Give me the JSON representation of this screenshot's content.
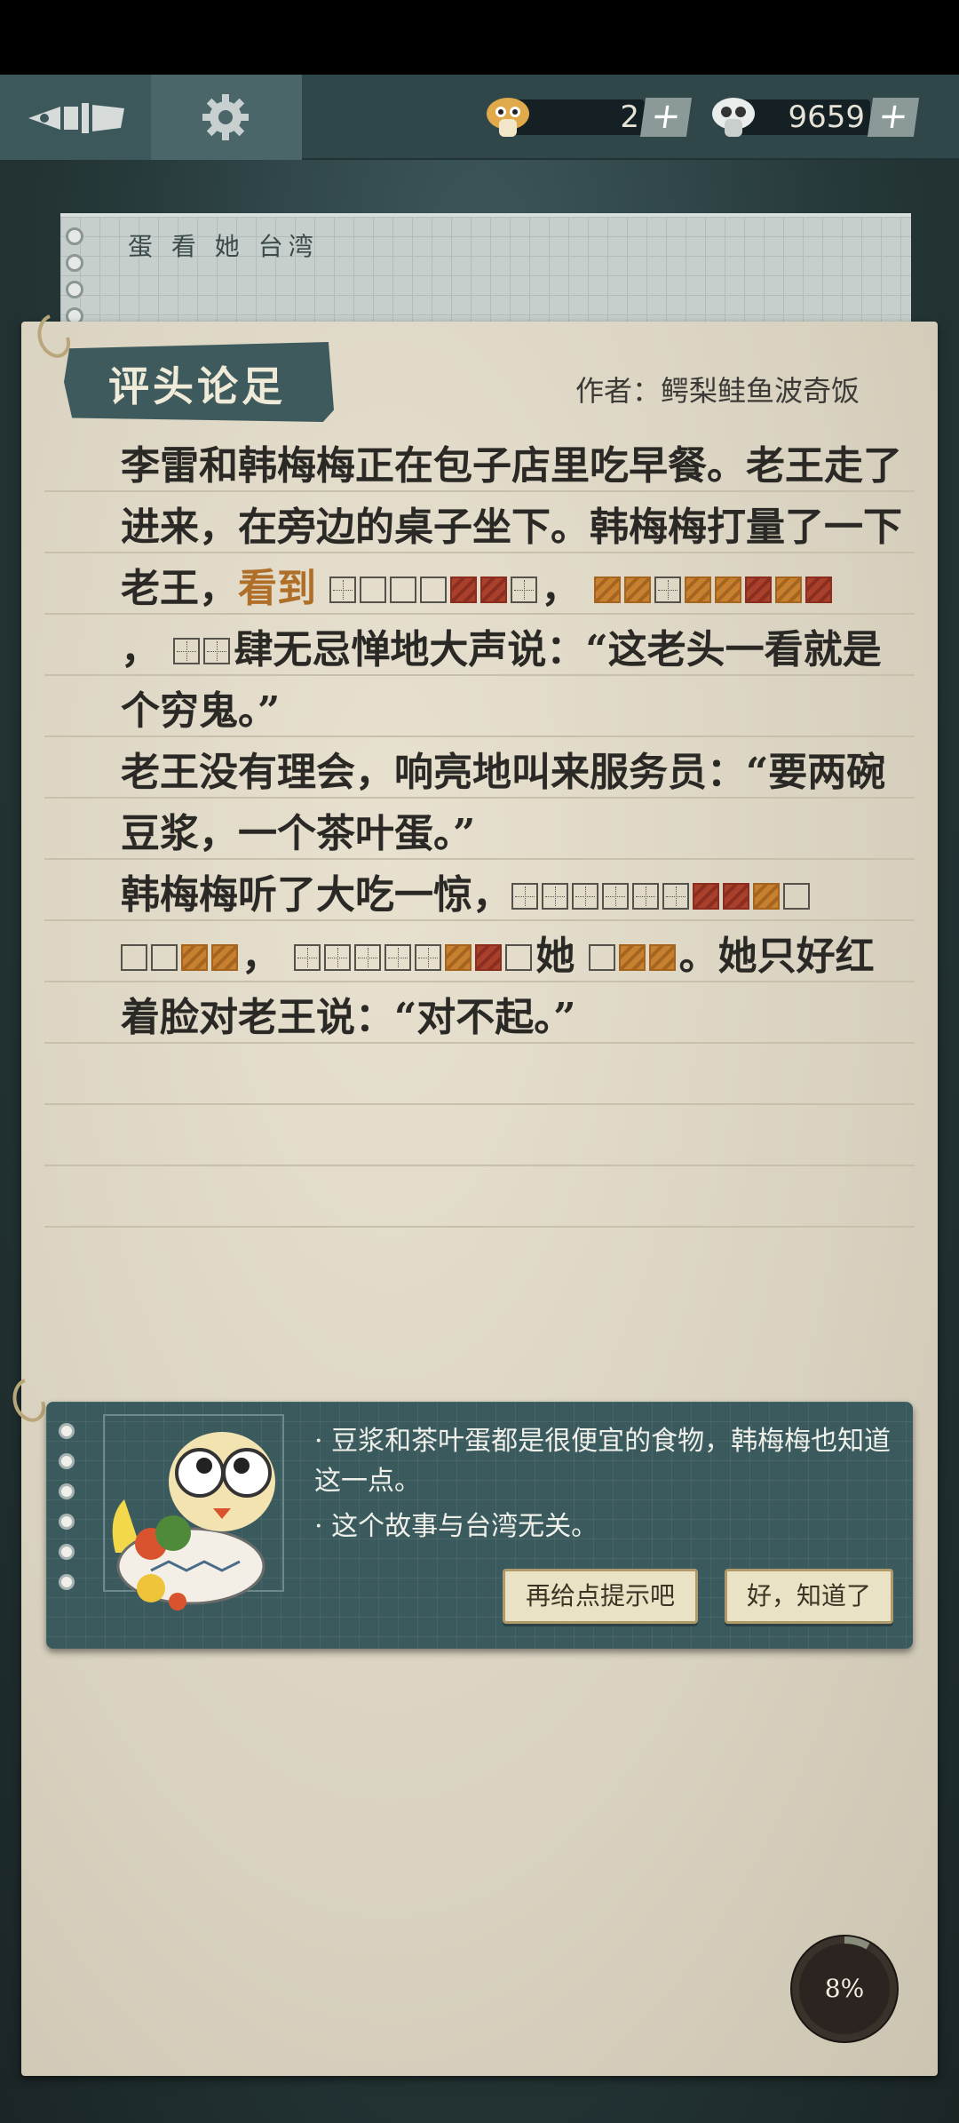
{
  "topbar": {
    "hints": {
      "value": "2",
      "plus": "+"
    },
    "coins": {
      "value": "9659",
      "plus": "+"
    }
  },
  "notepad": {
    "words": "蛋 看 她 台湾"
  },
  "card": {
    "title": "评头论足",
    "author": "作者：鳄梨鲑鱼波奇饭"
  },
  "story": {
    "p1a": "李雷和韩梅梅正在包子店里吃早餐。老王走了进来，在旁边的桌子坐下。韩梅梅打量了一下老王，",
    "p1_highlight": "看到",
    "p1b": "，",
    "p1c": "，",
    "p1d": "肆无忌惮地大声说：“这老头一看就是个穷鬼。”",
    "p2": "老王没有理会，响亮地叫来服务员：“要两碗豆浆，一个茶叶蛋。”",
    "p3a": "韩梅梅听了大吃一惊，",
    "p3b": "，",
    "p3c": "她",
    "p3d": "。她只好红着脸对老王说：“对不起。”"
  },
  "hint": {
    "items": [
      "·  豆浆和茶叶蛋都是很便宜的食物，韩梅梅也知道这一点。",
      "·  这个故事与台湾无关。"
    ],
    "more_hint_button": "再给点提示吧",
    "ok_button": "好，知道了"
  },
  "progress": {
    "label": "8%",
    "fraction": 0.08
  },
  "colors": {
    "panel": "#3b5a5d",
    "paper": "#dcd5c3",
    "highlight": "#b06f28",
    "red_block": "#a9402c",
    "orange_block": "#c6802f"
  }
}
